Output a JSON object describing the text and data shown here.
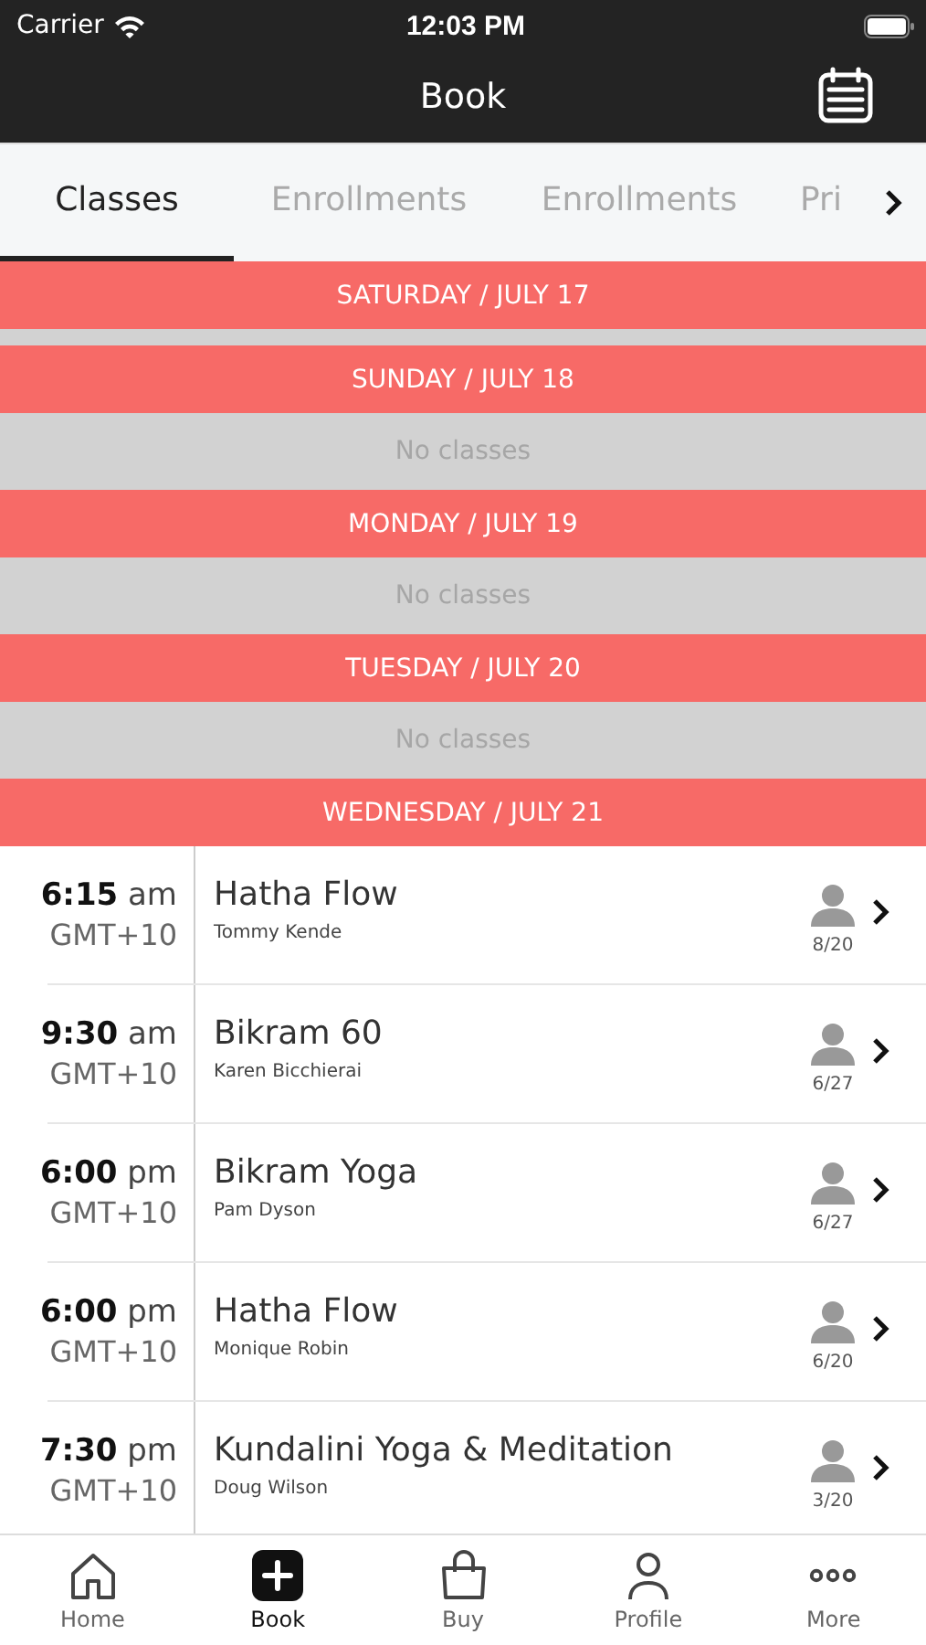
{
  "status_bar": {
    "carrier": "Carrier",
    "time": "12:03 PM"
  },
  "header": {
    "title": "Book"
  },
  "tabs": [
    {
      "label": "Classes",
      "selected": true
    },
    {
      "label": "Enrollments",
      "selected": false
    },
    {
      "label": "Enrollments",
      "selected": false
    },
    {
      "label": "Pri",
      "selected": false
    }
  ],
  "days": [
    {
      "title": "SATURDAY / JULY 17"
    },
    {
      "title": "SUNDAY / JULY 18",
      "note": "No classes"
    },
    {
      "title": "MONDAY / JULY 19",
      "note": "No classes"
    },
    {
      "title": "TUESDAY / JULY 20",
      "note": "No classes"
    },
    {
      "title": "WEDNESDAY / JULY 21",
      "classes": [
        {
          "time": "**6:15** am",
          "zone": "GMT+10",
          "name": "Hatha Flow",
          "teacher": "Tommy Kende",
          "spots": "8/20"
        },
        {
          "time": "**9:30** am",
          "zone": "GMT+10",
          "name": "Bikram 60",
          "teacher": "Karen Bicchierai",
          "spots": "6/27"
        },
        {
          "time": "**6:00** pm",
          "zone": "GMT+10",
          "name": "Bikram Yoga",
          "teacher": "Pam Dyson",
          "spots": "6/27"
        },
        {
          "time": "**6:00** pm",
          "zone": "GMT+10",
          "name": "Hatha Flow",
          "teacher": "Monique Robin",
          "spots": "6/20"
        },
        {
          "time": "**7:30** pm",
          "zone": "GMT+10",
          "name": "Kundalini Yoga & Meditation",
          "teacher": "Doug Wilson",
          "spots": "3/20"
        }
      ]
    }
  ],
  "nav": [
    {
      "label": "Home",
      "kind": "home",
      "selected": false
    },
    {
      "label": "Book",
      "kind": "book",
      "selected": true
    },
    {
      "label": "Buy",
      "kind": "buy",
      "selected": false
    },
    {
      "label": "Profile",
      "kind": "profile",
      "selected": false
    },
    {
      "label": "More",
      "kind": "more",
      "selected": false
    }
  ]
}
